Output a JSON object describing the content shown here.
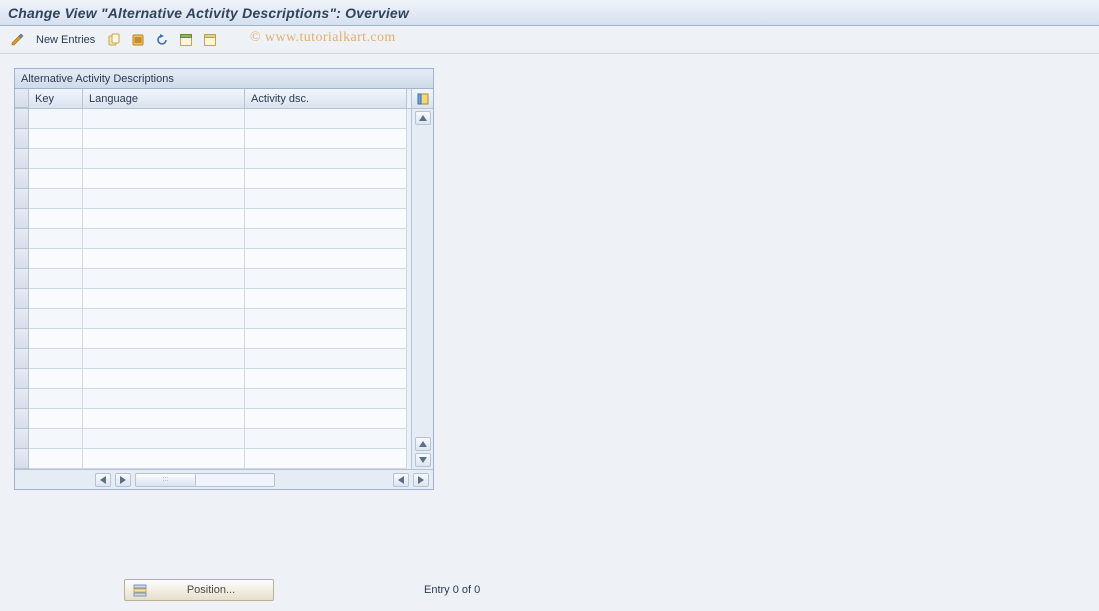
{
  "title": "Change View \"Alternative Activity Descriptions\": Overview",
  "watermark": "© www.tutorialkart.com",
  "toolbar": {
    "display_change_icon": "display-change-icon",
    "new_entries_label": "New Entries",
    "copy_icon": "copy-as-icon",
    "delete_icon": "delete-icon",
    "undo_icon": "undo-change-icon",
    "select_all_icon": "select-all-icon",
    "deselect_all_icon": "deselect-all-icon"
  },
  "panel": {
    "title": "Alternative Activity Descriptions",
    "columns": {
      "key": "Key",
      "language": "Language",
      "activity_dsc": "Activity dsc."
    },
    "config_icon": "table-settings-icon"
  },
  "footer": {
    "position_label": "Position...",
    "entry_text": "Entry 0 of 0"
  }
}
